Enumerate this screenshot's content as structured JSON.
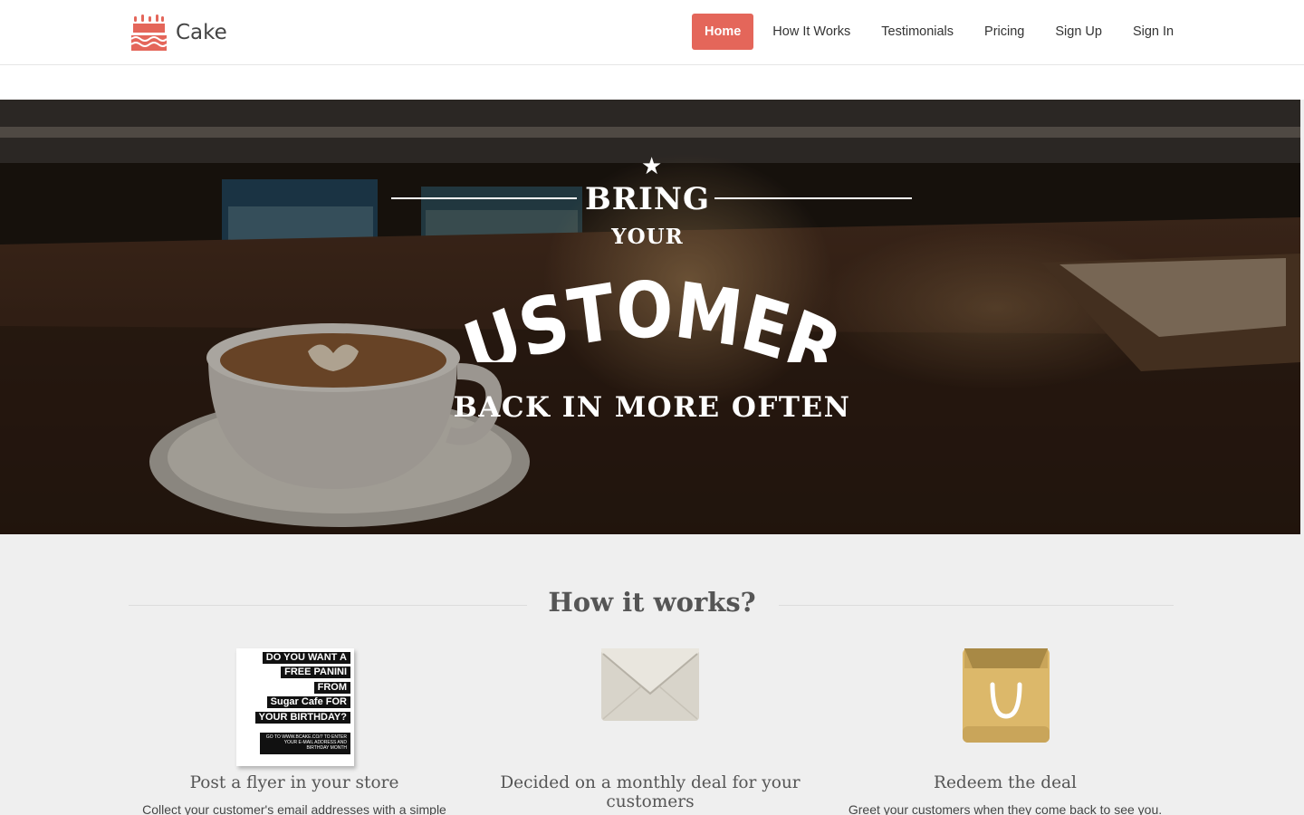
{
  "brand": {
    "name": "Cake"
  },
  "nav": {
    "items": [
      {
        "label": "Home",
        "active": true
      },
      {
        "label": "How It Works"
      },
      {
        "label": "Testimonials"
      },
      {
        "label": "Pricing"
      },
      {
        "label": "Sign Up"
      },
      {
        "label": "Sign In"
      }
    ]
  },
  "hero": {
    "line1": "BRING",
    "line2": "YOUR",
    "line3": "CUSTOMERS",
    "line4": "BACK IN MORE OFTEN"
  },
  "how": {
    "title": "How it works?",
    "steps": [
      {
        "title": "Post a flyer in your store",
        "desc": "Collect your customer's email addresses with a simple",
        "flyer": {
          "lines": [
            "DO YOU WANT A",
            "FREE PANINI",
            "FROM",
            "Sugar Cafe FOR",
            "YOUR BIRTHDAY?"
          ],
          "small": "GO TO WWW.BCAKE.CO/7 TO ENTER YOUR E-MAIL ADDRESS AND BIRTHDAY MONTH"
        }
      },
      {
        "title": "Decided on a monthly deal for your customers",
        "desc": ""
      },
      {
        "title": "Redeem the deal",
        "desc": "Greet your customers when they come back to see you."
      }
    ]
  },
  "colors": {
    "accent": "#e4665a",
    "text": "#555555"
  }
}
